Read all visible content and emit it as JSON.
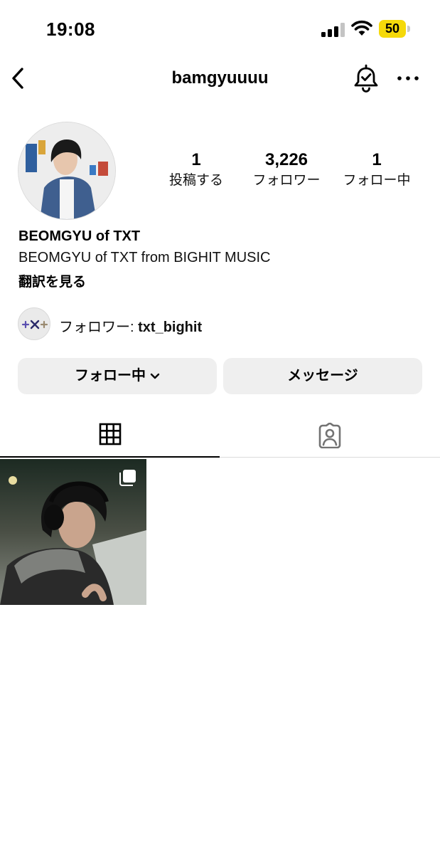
{
  "status_bar": {
    "time": "19:08",
    "battery": "50",
    "battery_color": "#f5d90a"
  },
  "nav": {
    "title": "bamgyuuuu",
    "icons": [
      "chevron-left-icon",
      "bell-check-icon",
      "more-horizontal-icon"
    ]
  },
  "profile": {
    "stats": [
      {
        "value": "1",
        "label": "投稿する"
      },
      {
        "value": "3,226",
        "label": "フォロワー"
      },
      {
        "value": "1",
        "label": "フォロー中"
      }
    ],
    "name": "BEOMGYU of TXT",
    "bio": "BEOMGYU of TXT from BIGHIT MUSIC",
    "translate_label": "翻訳を見る",
    "followed_by_prefix": "フォロワー: ",
    "followed_by_user": "txt_bighit"
  },
  "buttons": {
    "following": "フォロー中",
    "message": "メッセージ"
  },
  "tabs": [
    {
      "icon": "grid-icon",
      "active": true
    },
    {
      "icon": "tagged-person-icon",
      "active": false
    }
  ],
  "posts": [
    {
      "icon": "carousel-icon"
    }
  ]
}
